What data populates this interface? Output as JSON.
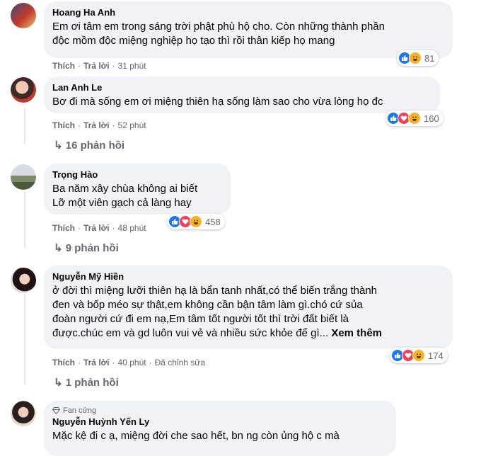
{
  "actions": {
    "like": "Thích",
    "reply": "Trả lời",
    "edited": "Đã chỉnh sửa"
  },
  "colors": {
    "like": "#1877f2",
    "love": "#f33e58",
    "haha": "#f7b125",
    "bubble": "#f0f2f5",
    "meta": "#65676b"
  },
  "comments": [
    {
      "name": "Hoang Ha Anh",
      "lines": [
        "Em ơi tâm em trong sáng trời phật phù hộ cho. Còn những thành phần",
        "độc mồm độc miệng nghiệp họ tạo thì rồi thân kiếp họ mang"
      ],
      "time": "31 phút",
      "reactions": [
        "like-icon",
        "haha-icon"
      ],
      "reaction_count": "81"
    },
    {
      "name": "Lan Anh Le",
      "lines": [
        "Bơ đi mà sống em ơi miệng thiên hạ sống làm sao cho vừa lòng họ đc"
      ],
      "time": "52 phút",
      "reactions": [
        "like-icon",
        "love-icon",
        "haha-icon"
      ],
      "reaction_count": "160",
      "replies": "16 phản hồi"
    },
    {
      "name": "Trọng Hào",
      "lines": [
        "Ba năm xây chùa không ai biết",
        "Lỡ một viên gạch cả làng hay"
      ],
      "time": "48 phút",
      "reactions": [
        "like-icon",
        "love-icon",
        "haha-icon"
      ],
      "reaction_count": "458",
      "replies": "9 phản hồi"
    },
    {
      "name": "Nguyễn Mỹ Hiền",
      "lines": [
        "ở đời thì miệng lưỡi thiên hạ là bẩn tanh nhất,có thể biến trắng thành",
        "đen và bốp méo sự thật,em không cần bận tâm làm gì.chó cứ sủa",
        "đoàn người cứ đi em nạ,Em tâm tốt người tốt thì trời đất biết là",
        "được.chúc em và gd luôn vui vẻ và nhiều sức khỏe để gì..."
      ],
      "see_more": "Xem thêm",
      "time": "40 phút",
      "reactions": [
        "like-icon",
        "love-icon",
        "haha-icon"
      ],
      "reaction_count": "174",
      "replies": "1 phản hồi"
    },
    {
      "badge": "Fan cứng",
      "name": "Nguyễn Huỳnh Yến Ly",
      "lines": [
        "Mặc kệ đi c ạ, miệng đời che sao hết, bn ng còn ủng hộ c mà"
      ]
    }
  ]
}
